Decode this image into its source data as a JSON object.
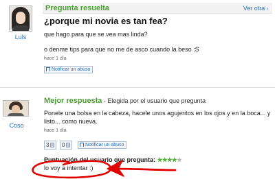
{
  "question": {
    "status": "Pregunta resuelta",
    "more_link": "Ver otra",
    "asker": {
      "name": "Luls"
    },
    "title": "¿porque mi novia es tan fea?",
    "body_lines": [
      "que hago para que se vea mas linda?",
      "o denme tips para que no me de asco cuando la beso :S"
    ],
    "time": "hace 1 día",
    "report_label": "Notificar un abuso"
  },
  "best_answer": {
    "heading": "Mejor respuesta",
    "chosen_by": "- Elegida por el usuario que pregunta",
    "answerer": {
      "name": "Coso"
    },
    "body_lines": [
      "Ponele una bolsa en la cabeza, hacele unos agujeritos en los ojos y en la boca... y",
      "listo... como nueva."
    ],
    "time": "hace 1 día",
    "votes": {
      "up": "3",
      "down": "0"
    },
    "report_label": "Notificar un abuso",
    "rating_label": "Puntuación del usuario que pregunta:",
    "rating": {
      "value": 4,
      "max": 5
    },
    "asker_comment": "lo voy a intentar :)"
  },
  "colors": {
    "status_green": "#4aa032",
    "link_blue": "#2a6fb8",
    "annotation_red": "#e00000"
  },
  "icons": [
    "flag-icon",
    "thumbs-up-icon",
    "thumbs-down-icon",
    "star-icon",
    "chevron-right-icon"
  ]
}
